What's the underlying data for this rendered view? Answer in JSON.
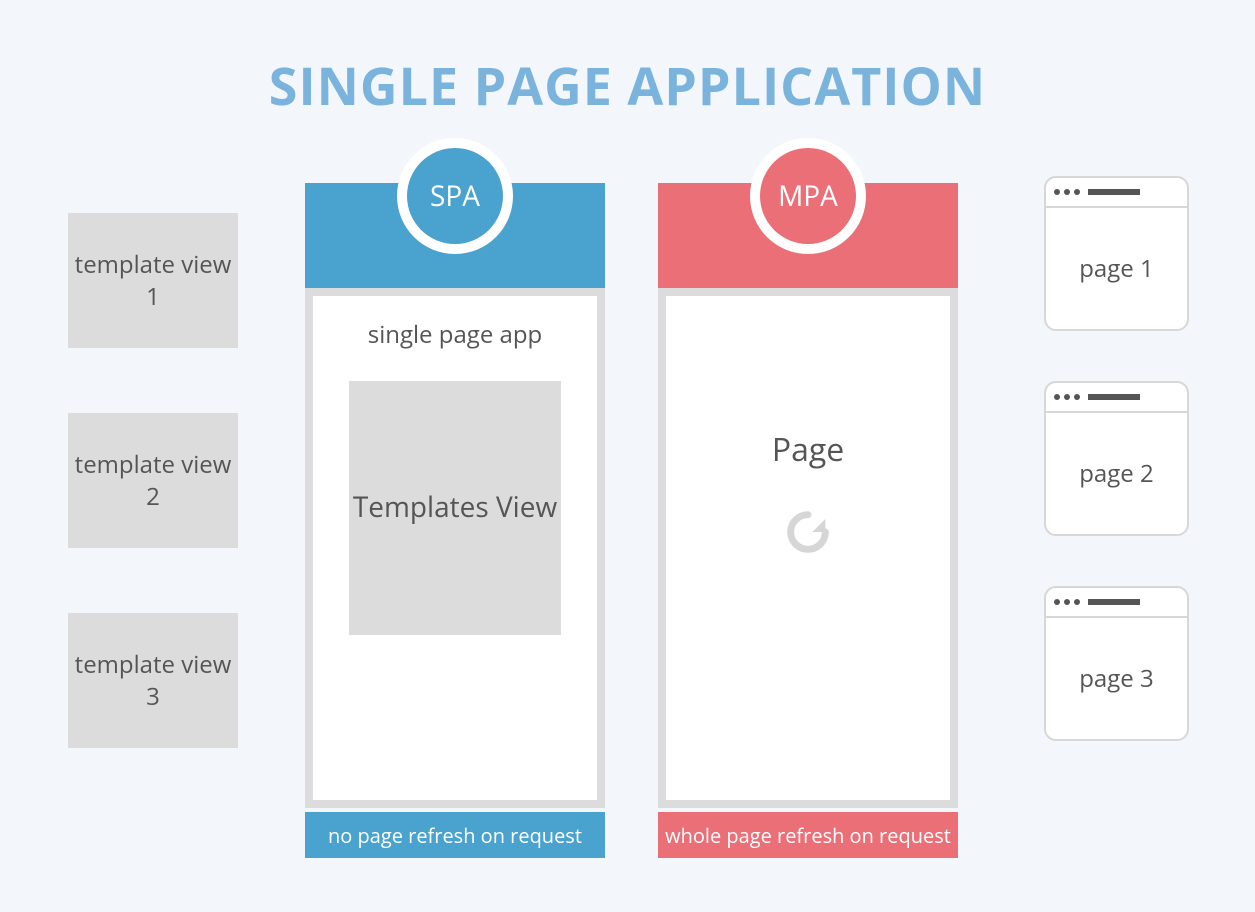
{
  "title": "SINGLE PAGE APPLICATION",
  "left": {
    "tv1": "template view 1",
    "tv2": "template view 2",
    "tv3": "template view 3"
  },
  "spa": {
    "badge": "SPA",
    "subtitle": "single page app",
    "templates_view": "Templates View",
    "footer": "no page refresh on request"
  },
  "mpa": {
    "badge": "MPA",
    "page": "Page",
    "footer": "whole page refresh on request"
  },
  "right": {
    "p1": "page 1",
    "p2": "page 2",
    "p3": "page 3"
  }
}
